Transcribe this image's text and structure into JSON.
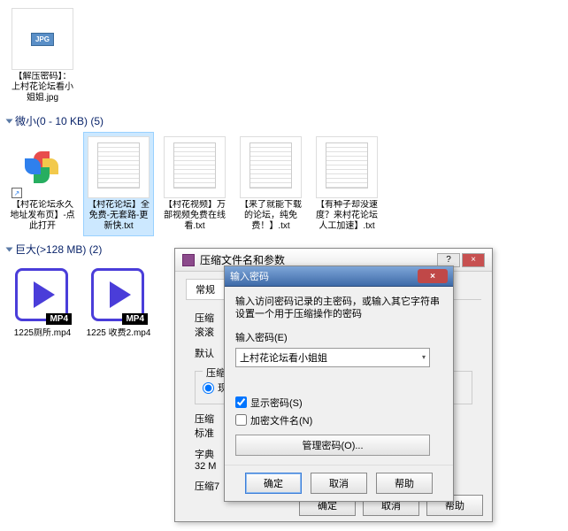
{
  "groups": {
    "tiny": {
      "label": "微小(0 - 10 KB) (5)"
    },
    "huge": {
      "label": "巨大(>128 MB) (2)"
    }
  },
  "files": {
    "jpg": {
      "label": "【解压密码】：上村花论坛看小姐姐.jpg",
      "badge": "JPG"
    },
    "pinwheel": {
      "label": "【村花论坛永久地址发布页】-点此打开"
    },
    "txt1": {
      "label": "【村花论坛】全免费-无套路-更新快.txt"
    },
    "txt2": {
      "label": "【村花视频】万部视频免费在线看.txt"
    },
    "txt3": {
      "label": "【来了就能下载的论坛，纯免费！】.txt"
    },
    "txt4": {
      "label": "【有种子却没速度？来村花论坛人工加速】.txt"
    },
    "mp4a": {
      "label": "1225厕所.mp4",
      "badge": "MP4"
    },
    "mp4b": {
      "label": "1225 收费2.mp4",
      "badge": "MP4"
    }
  },
  "under_dialog": {
    "title": "压缩文件名和参数",
    "tab": "常规",
    "labels": {
      "compress": "压缩",
      "default": "默认",
      "compress2": "压缩",
      "radio": "现",
      "compress_size": "压缩",
      "std": "标准",
      "dict": "字典",
      "dict_val": "32 M",
      "compress3": "压缩7"
    },
    "buttons": {
      "ok": "确定",
      "cancel": "取消",
      "help": "帮助"
    },
    "win_help": "?",
    "win_close": "×"
  },
  "pwd_dialog": {
    "title": "输入密码",
    "close": "×",
    "info": "输入访问密码记录的主密码，或输入其它字符串设置一个用于压缩操作的密码",
    "pwd_label": "输入密码(E)",
    "pwd_value": "上村花论坛看小姐姐",
    "show_pwd": "显示密码(S)",
    "encrypt_names": "加密文件名(N)",
    "manage": "管理密码(O)...",
    "buttons": {
      "ok": "确定",
      "cancel": "取消",
      "help": "帮助"
    }
  }
}
